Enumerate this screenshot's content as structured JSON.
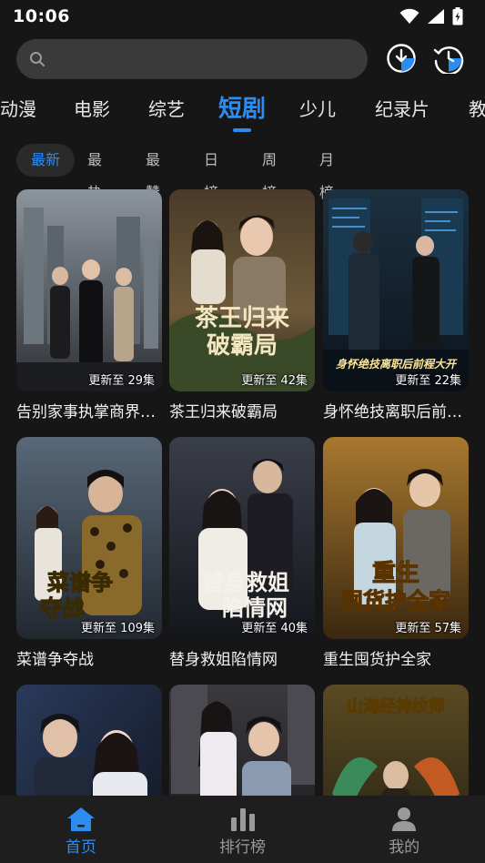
{
  "status_bar": {
    "time": "10:06"
  },
  "search": {
    "placeholder": ""
  },
  "categories": [
    {
      "label": "动漫"
    },
    {
      "label": "电影"
    },
    {
      "label": "综艺"
    },
    {
      "label": "短剧",
      "active": true
    },
    {
      "label": "少儿"
    },
    {
      "label": "纪录片"
    },
    {
      "label": "教"
    }
  ],
  "sort_tabs": [
    {
      "label": "最新",
      "active": true
    },
    {
      "label": "最热"
    },
    {
      "label": "最赞"
    },
    {
      "label": "日榜"
    },
    {
      "label": "周榜"
    },
    {
      "label": "月榜"
    }
  ],
  "cards": [
    {
      "title": "告别家事执掌商界…",
      "badge": "更新至 29集",
      "poster_text": ""
    },
    {
      "title": "茶王归来破霸局",
      "badge": "更新至 42集",
      "poster_text": "茶王归来破霸局"
    },
    {
      "title": "身怀绝技离职后前…",
      "badge": "更新至 22集",
      "poster_text": "身怀绝技离职后前程大开"
    },
    {
      "title": "菜谱争夺战",
      "badge": "更新至 109集",
      "poster_text": "菜谱争夺战"
    },
    {
      "title": "替身救姐陷情网",
      "badge": "更新至 40集",
      "poster_text": "替身救姐陷情网"
    },
    {
      "title": "重生囤货护全家",
      "badge": "更新至 57集",
      "poster_text": "重生囤货护全家"
    },
    {
      "title": "",
      "badge": "",
      "poster_text": ""
    },
    {
      "title": "",
      "badge": "",
      "poster_text": ""
    },
    {
      "title": "",
      "badge": "",
      "poster_text": "山海经神纹师"
    }
  ],
  "bottom_nav": [
    {
      "label": "首页",
      "icon": "home-icon",
      "active": true
    },
    {
      "label": "排行榜",
      "icon": "ranking-icon"
    },
    {
      "label": "我的",
      "icon": "profile-icon"
    }
  ],
  "colors": {
    "accent": "#2d8cf0",
    "background": "#161616",
    "search_bg": "#3a3a3a"
  }
}
